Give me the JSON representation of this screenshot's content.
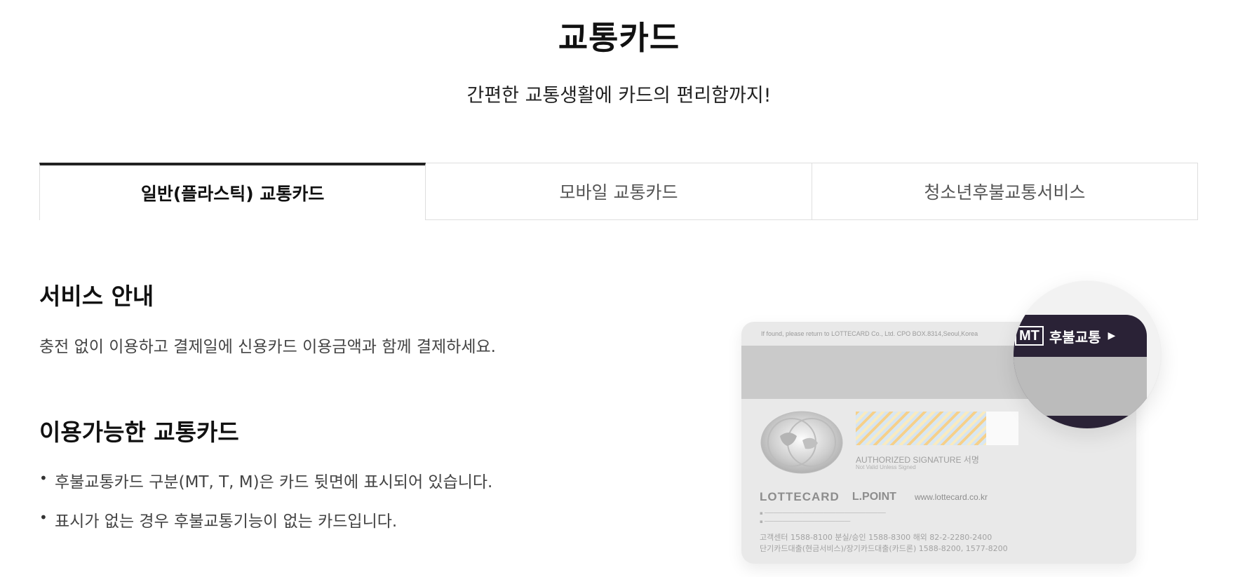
{
  "header": {
    "title": "교통카드",
    "subtitle": "간편한 교통생활에 카드의 편리함까지!"
  },
  "tabs": [
    {
      "label": "일반(플라스틱) 교통카드",
      "active": true
    },
    {
      "label": "모바일 교통카드",
      "active": false
    },
    {
      "label": "청소년후불교통서비스",
      "active": false
    }
  ],
  "service": {
    "heading": "서비스 안내",
    "description": "충전 없이 이용하고 결제일에 신용카드 이용금액과 함께 결제하세요."
  },
  "available_cards": {
    "heading": "이용가능한 교통카드",
    "bullets": [
      "후불교통카드 구분(MT, T, M)은 카드 뒷면에 표시되어 있습니다.",
      "표시가 없는 경우 후불교통기능이 없는 카드입니다."
    ]
  },
  "card_image": {
    "return_text": "If found, please return to LOTTECARD Co., Ltd. CPO BOX.8314,Seoul,Korea",
    "signature_label": "AUTHORIZED SIGNATURE 서명",
    "signature_sub": "Not Valid Unless Signed",
    "brand": "LOTTECARD",
    "brand2": "L.POINT",
    "website": "www.lottecard.co.kr",
    "phone_line1": "고객센터 1588-8100   분실/승인 1588-8300   해외 82-2-2280-2400",
    "phone_line2": "단기카드대출(현금서비스)/장기카드대출(카드론) 1588-8200, 1577-8200",
    "magnifier_badge": "MT",
    "magnifier_label": "후불교통",
    "colors": {
      "magnifier_bg": "#2a2236",
      "card_bg": "#e9e9e9"
    }
  }
}
